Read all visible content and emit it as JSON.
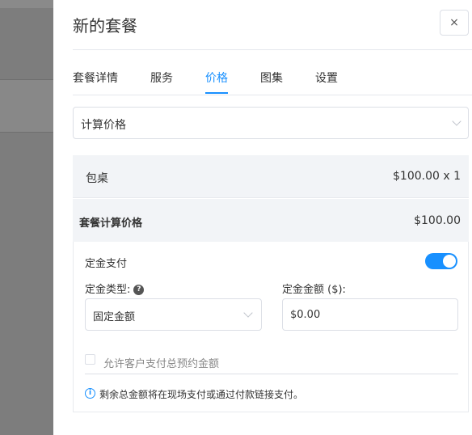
{
  "drawer": {
    "title": "新的套餐",
    "close_glyph": "×"
  },
  "tabs": [
    {
      "label": "套餐详情",
      "active": false
    },
    {
      "label": "服务",
      "active": false
    },
    {
      "label": "价格",
      "active": true
    },
    {
      "label": "图集",
      "active": false
    },
    {
      "label": "设置",
      "active": false
    }
  ],
  "pricing_mode": {
    "value": "计算价格"
  },
  "line_items": [
    {
      "name": "包桌",
      "price": "$100.00 x 1"
    }
  ],
  "total": {
    "label": "套餐计算价格",
    "value": "$100.00"
  },
  "deposit": {
    "label": "定金支付",
    "enabled": true,
    "type_label": "定金类型:",
    "type_help_glyph": "?",
    "type_value": "固定金额",
    "amount_label": "定金金额 ($):",
    "amount_value": "$0.00",
    "allow_full_label": "允许客户支付总预约金额",
    "allow_full_checked": false,
    "info_glyph": "i",
    "info_text": "剩余总金额将在现场支付或通过付款链接支付。"
  },
  "colors": {
    "accent": "#1890ff"
  }
}
